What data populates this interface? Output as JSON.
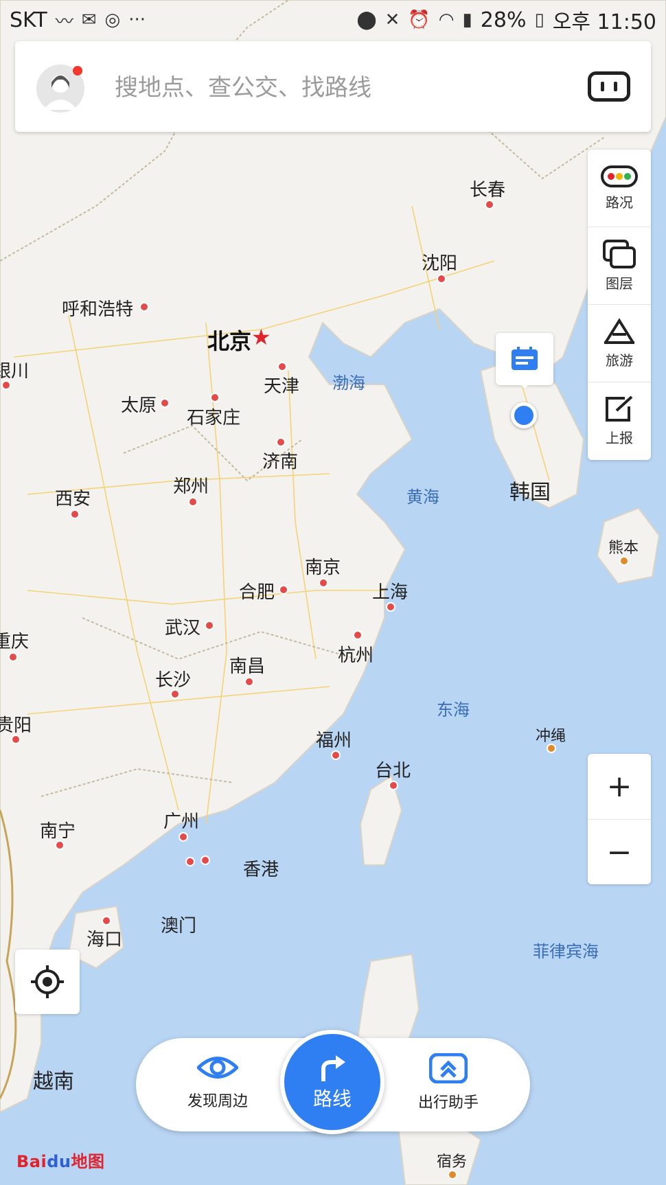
{
  "status_bar": {
    "carrier": "SKT",
    "battery": "28%",
    "time": "오후 11:50"
  },
  "search": {
    "placeholder": "搜地点、查公交、找路线"
  },
  "side_panel": {
    "items": [
      {
        "label": "路况",
        "icon": "traffic-icon"
      },
      {
        "label": "图层",
        "icon": "layers-icon"
      },
      {
        "label": "旅游",
        "icon": "travel-icon"
      },
      {
        "label": "上报",
        "icon": "report-icon"
      }
    ]
  },
  "zoom": {
    "in": "+",
    "out": "−"
  },
  "bottom_bar": {
    "discover": "发现周边",
    "route": "路线",
    "assistant": "出行助手"
  },
  "brand": {
    "name_a": "Bai",
    "name_b": "du",
    "name_c": "地图"
  },
  "map": {
    "cities": [
      "长春",
      "沈阳",
      "呼和浩特",
      "北京",
      "天津",
      "太原",
      "石家庄",
      "济南",
      "郑州",
      "西安",
      "南京",
      "合肥",
      "上海",
      "武汉",
      "杭州",
      "南昌",
      "长沙",
      "重庆",
      "贵阳",
      "福州",
      "台北",
      "广州",
      "南宁",
      "香港",
      "澳门",
      "海口",
      "熊本",
      "冲绳",
      "宿务",
      "银川"
    ],
    "seas": [
      "渤海",
      "黄海",
      "东海",
      "菲律宾海"
    ],
    "countries": [
      "韩国",
      "越南"
    ]
  }
}
